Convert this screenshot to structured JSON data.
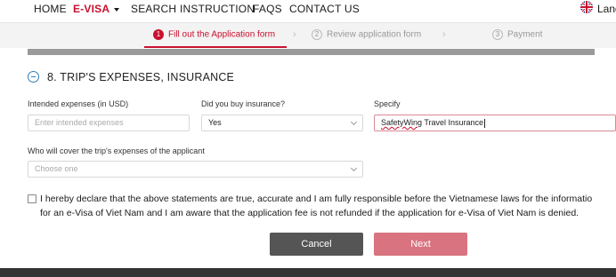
{
  "nav": {
    "home": "HOME",
    "evisa": "E-VISA",
    "search": "SEARCH",
    "instruction": "INSTRUCTION",
    "faqs": "FAQS",
    "contact": "CONTACT US",
    "lang": "Lang"
  },
  "stepper": {
    "steps": [
      {
        "num": "1",
        "label": "Fill out the Application form"
      },
      {
        "num": "2",
        "label": "Review application form"
      },
      {
        "num": "3",
        "label": "Payment"
      }
    ]
  },
  "section": {
    "title": "8. TRIP'S EXPENSES, INSURANCE"
  },
  "form": {
    "expenses_label": "Intended expenses (in USD)",
    "expenses_placeholder": "Enter intended expenses",
    "insurance_label": "Did you buy insurance?",
    "insurance_value": "Yes",
    "specify_label": "Specify",
    "specify_value_word": "SafetyWing",
    "specify_value_rest": " Travel Insurance",
    "cover_label": "Who will cover the trip's expenses of the applicant",
    "cover_placeholder": "Choose one"
  },
  "declaration": {
    "line1": "I hereby declare that the above statements are true, accurate and I am fully responsible before the Vietnamese laws for the informatio",
    "line2": "for an e-Visa of Viet Nam and I am aware that the application fee is not refunded if the application for e-Visa of Viet Nam is denied."
  },
  "buttons": {
    "cancel": "Cancel",
    "next": "Next"
  },
  "colors": {
    "accent": "#c8102e",
    "next_button": "#d9737f",
    "cancel_button": "#555555",
    "section_icon": "#2d7fb8"
  }
}
